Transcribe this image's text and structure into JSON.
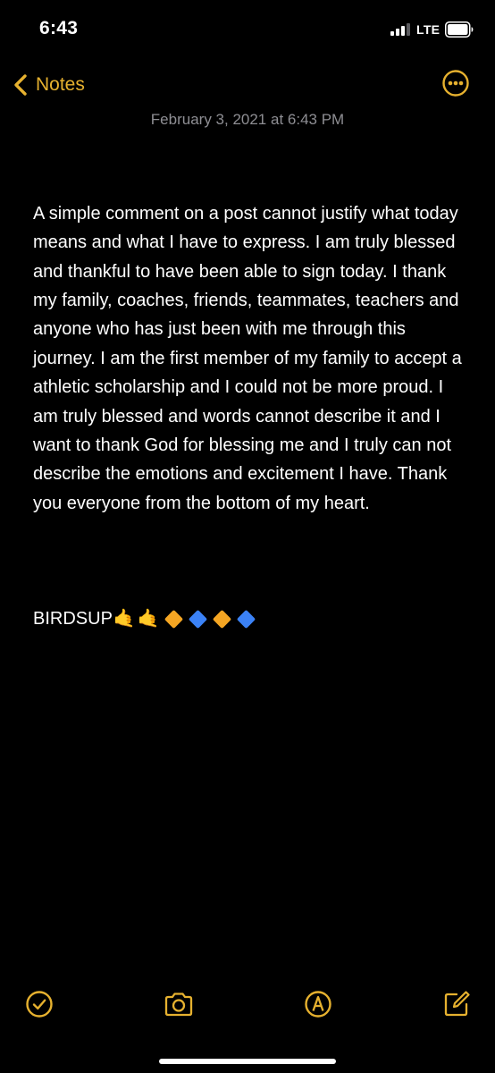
{
  "status_bar": {
    "time": "6:43",
    "network": "LTE"
  },
  "nav": {
    "back_label": "Notes",
    "back_icon": "chevron-left-icon",
    "more_icon": "ellipsis-circle-icon"
  },
  "note": {
    "date": "February 3, 2021 at 6:43 PM",
    "body": "A simple comment on a post cannot justify what today means and what I have to express. I am truly blessed and thankful to have been able to sign today. I thank my family, coaches, friends, teammates, teachers and anyone who has just been with me through this journey. I am the first member of my family to accept a athletic scholarship and I could not be more proud. I am truly blessed and words cannot describe it and I want to thank God for blessing me and I truly can not describe the emotions and excitement I have. Thank you everyone from the bottom of my heart.",
    "signoff": "BIRDSUP",
    "emojis": [
      "🤙",
      "🤙",
      "🔶",
      "🔷",
      "🔶",
      "🔷"
    ]
  },
  "toolbar": {
    "items": [
      "checklist-icon",
      "camera-icon",
      "markup-icon",
      "compose-icon"
    ]
  },
  "colors": {
    "accent": "#e6b12f",
    "background": "#000000",
    "text": "#ffffff",
    "secondary_text": "#8e8e93",
    "orange_diamond": "#f5a623",
    "blue_diamond": "#3b82f6"
  }
}
